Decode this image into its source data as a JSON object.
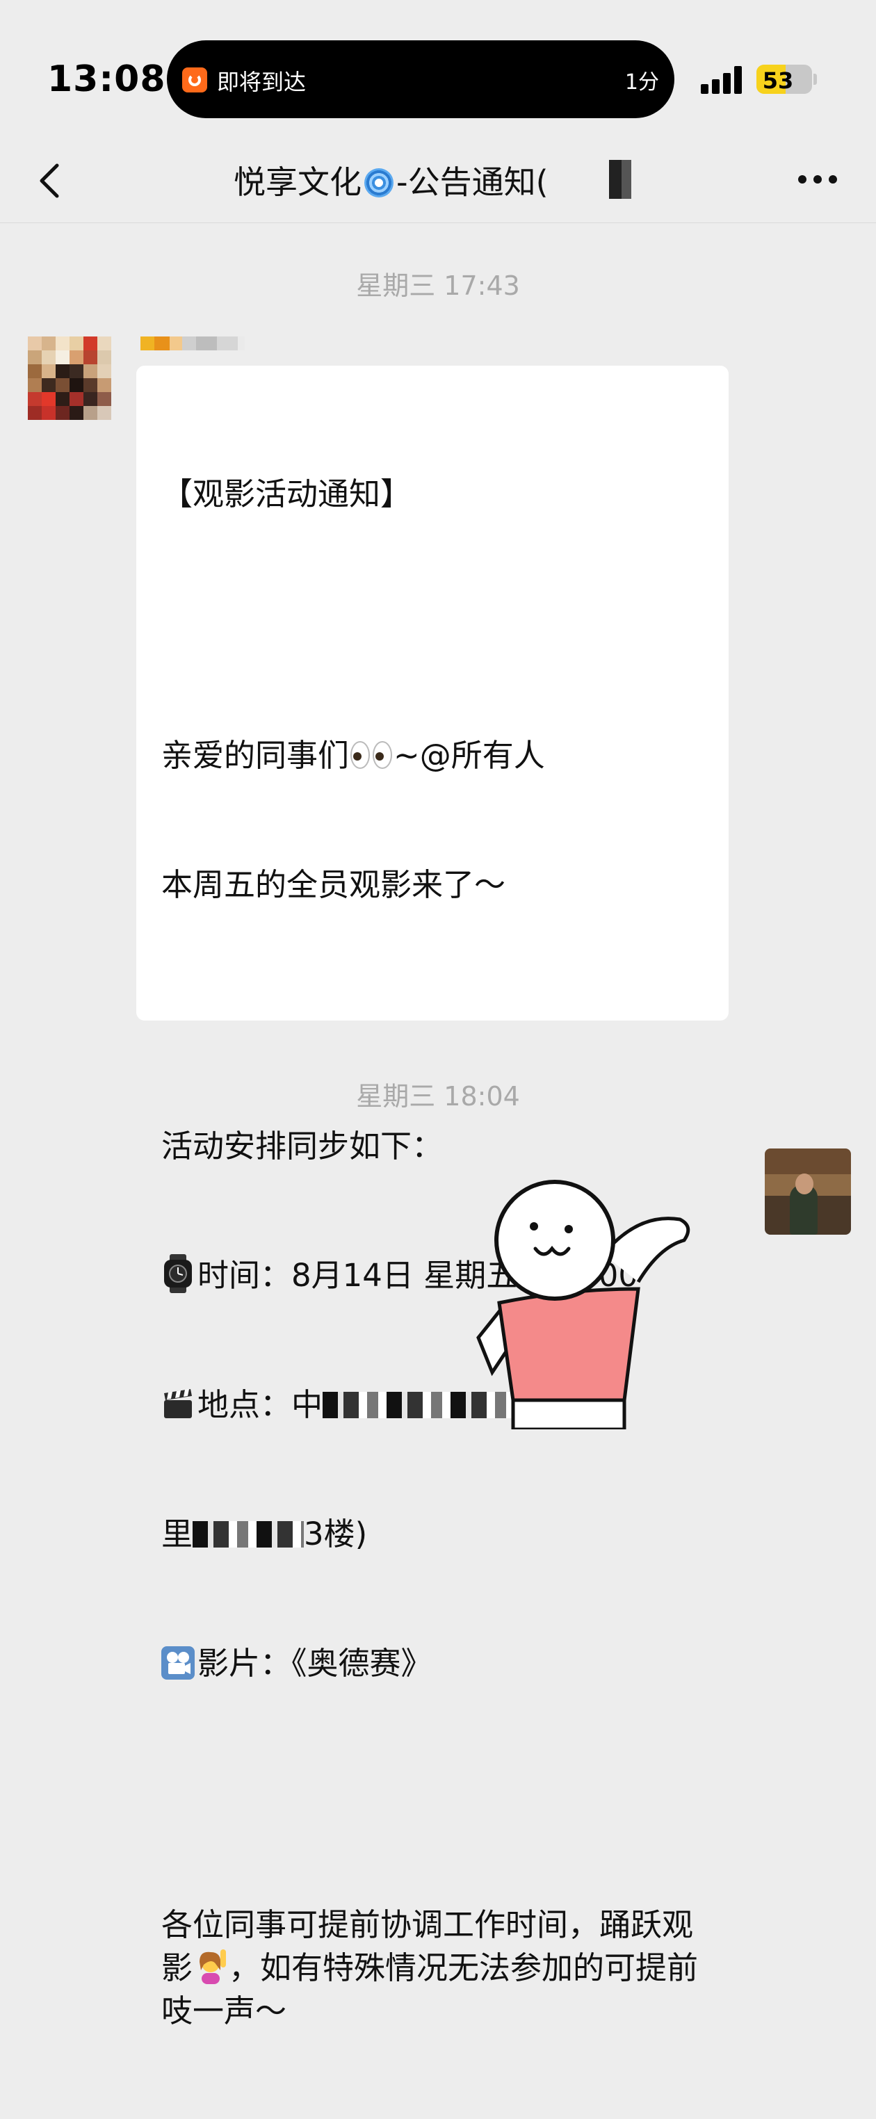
{
  "status_bar": {
    "time": "13:08",
    "live_activity": {
      "text": "即将到达",
      "eta": "1分"
    },
    "battery": {
      "level": 53,
      "label": "53",
      "color": "#f7d21c"
    }
  },
  "nav": {
    "title_prefix": "悦享文化",
    "title_suffix": "-公告通知("
  },
  "messages": {
    "timestamp_1": "星期三 17:43",
    "notice": {
      "heading": "【观影活动通知】",
      "greeting": "亲爱的同事们",
      "greeting_tail": "~@所有人",
      "line_2": "本周五的全员观影来了～",
      "schedule_intro": "活动安排同步如下：",
      "time_label": "时间：8月14日 星期五 13：00",
      "location_label": "地点：中",
      "location_tail_1": "科",
      "location_tail_2": "里",
      "location_tail_3": "3楼)",
      "film_label": "影片：《奥德赛》",
      "closing": "各位同事可提前协调工作时间，踊跃观影",
      "closing_tail": "，如有特殊情况无法参加的可提前吱一声～"
    },
    "timestamp_2": "星期三 18:04"
  }
}
